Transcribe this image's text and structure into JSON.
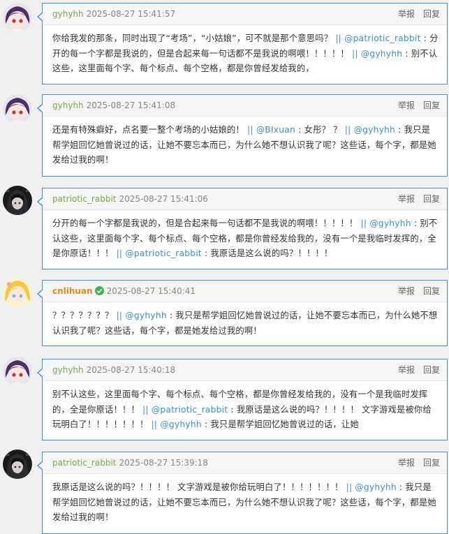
{
  "actions": {
    "report": "举报",
    "reply": "回复"
  },
  "colors": {
    "accent": "#3d8fcf",
    "username_green": "#7aab4a",
    "username_orange": "#e08a1e",
    "verified_badge": "#3fae54"
  },
  "comments": [
    {
      "user": "gyhyhh",
      "time": "2025-08-27 15:41:57",
      "avatar": "purple-hair-avatar",
      "text_a": "你给我发的那条，同时出现了“考场”，“小姑娘”，可不就是那个意思吗？ ",
      "sep_1": "||",
      "mention_1": "@patriotic_rabbit",
      "text_b": " : 分开的每一个字都是我说的，但是合起来每一句话都不是我说的啊喂！！！！！ ",
      "sep_2": "||",
      "mention_2": "@gyhyhh",
      "text_c": " : 别不认这些，这里面每个字、每个标点、每个空格，都是你曾经发给我的，"
    },
    {
      "user": "gyhyhh",
      "time": "2025-08-27 15:41:08",
      "avatar": "purple-hair-avatar",
      "text_a": "还是有特殊癖好，点名要一整个考场的小姑娘的！ ",
      "sep_1": "||",
      "mention_1": "@BIxuan",
      "text_b": " : 女彤？ ？ ",
      "sep_2": "||",
      "mention_2": "@gyhyhh",
      "text_c": " : 我只是帮学姐回忆她曾说过的话，让她不要忘本而已，为什么她不想认识我了呢？这些话，每个字，都是她发给过我的啊！"
    },
    {
      "user": "patriotic_rabbit",
      "time": "2025-08-27 15:41:06",
      "avatar": "dark-hair-avatar",
      "text_a": "分开的每一个字都是我说的，但是合起来每一句话都不是我说的啊喂！！！！！ ",
      "sep_1": "||",
      "mention_1": "@gyhyhh",
      "text_b": " : 别不认这些，这里面每个字、每个标点、每个空格，都是你曾经发给我的，没有一个是我临时发挥的，全是你原话！！！ ",
      "sep_2": "||",
      "mention_2": "@patriotic_rabbit",
      "text_c": " : 我原话是这么说的吗？！！！！"
    },
    {
      "user": "cnlihuan",
      "time": "2025-08-27 15:40:41",
      "avatar": "blonde-avatar",
      "verified": true,
      "text_a": "？？？？？？？ ",
      "sep_1": "||",
      "mention_1": "@gyhyhh",
      "text_b": " : 我只是帮学姐回忆她曾说过的话，让她不要忘本而已，为什么她不想认识我了呢？这些话，每个字，都是她发给过我的啊！",
      "sep_2": "",
      "mention_2": "",
      "text_c": ""
    },
    {
      "user": "gyhyhh",
      "time": "2025-08-27 15:40:18",
      "avatar": "purple-hair-avatar",
      "text_a": "别不认这些，这里面每个字、每个标点、每个空格，都是你曾经发给我的，没有一个是我临时发挥的，全是你原话！！！ ",
      "sep_1": "||",
      "mention_1": "@patriotic_rabbit",
      "text_b": " : 我原话是这么说的吗？！！！！ 文字游戏是被你给玩明白了！！！！！！！ ",
      "sep_2": "||",
      "mention_2": "@gyhyhh",
      "text_c": " : 我只是帮学姐回忆她曾说过的话，让她"
    },
    {
      "user": "patriotic_rabbit",
      "time": "2025-08-27 15:39:18",
      "avatar": "dark-hair-avatar",
      "text_a": "我原话是这么说的吗？！！！！ 文字游戏是被你给玩明白了！！！！！！！ ",
      "sep_1": "||",
      "mention_1": "@gyhyhh",
      "text_b": " : 我只是帮学姐回忆她曾说过的话，让她不要忘本而已，为什么她不想认识我了呢？这些话，每个字，都是她发给过我的啊！",
      "sep_2": "",
      "mention_2": "",
      "text_c": ""
    }
  ]
}
